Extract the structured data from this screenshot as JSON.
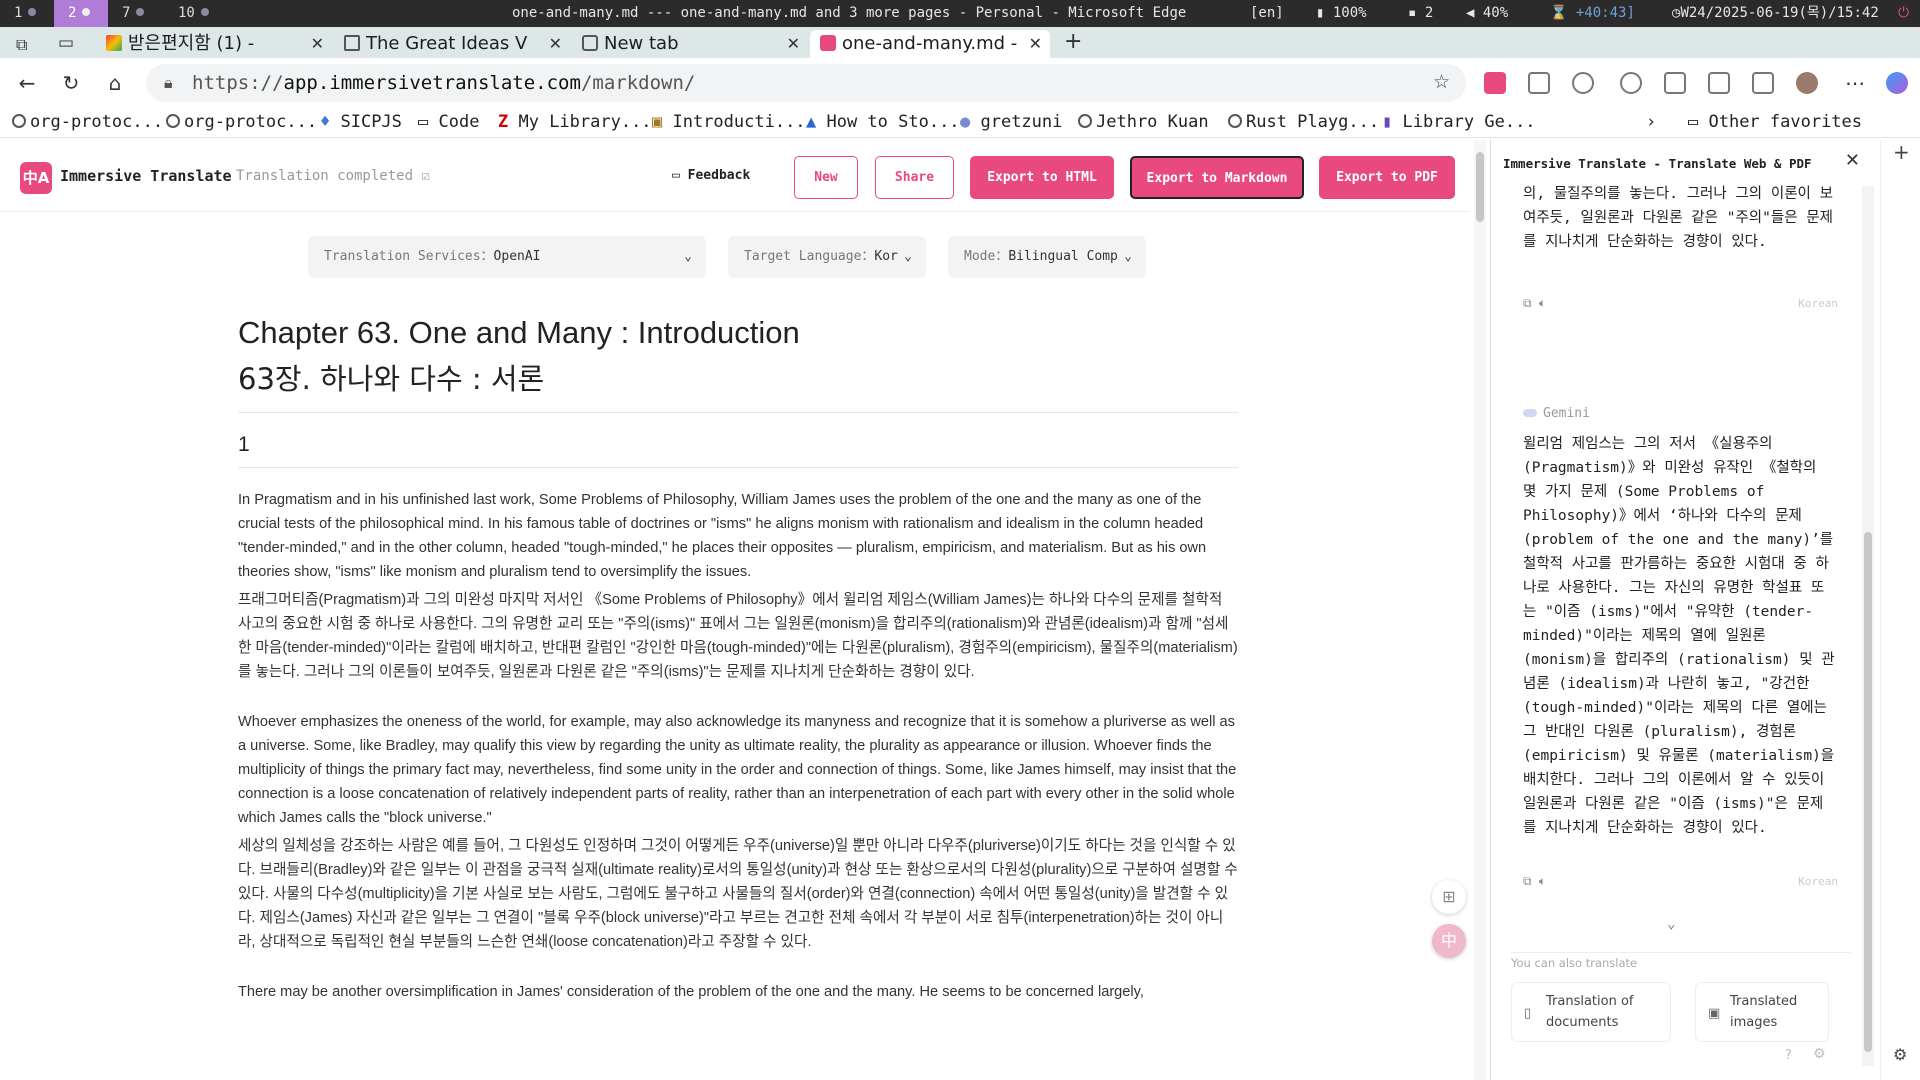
{
  "system_bar": {
    "workspaces": [
      {
        "label": "1",
        "active": false
      },
      {
        "label": "2",
        "active": true
      },
      {
        "label": "7",
        "active": false
      },
      {
        "label": "10",
        "active": false
      }
    ],
    "window_title": "one-and-many.md --- one-and-many.md and 3 more pages - Personal - Microsoft Edge",
    "input_method": "[en]",
    "battery": "100%",
    "notifications": "2",
    "volume": "40%",
    "timer": "+40:43]",
    "datetime": "W24/2025-06-19(목)/15:42"
  },
  "tabs": [
    {
      "title": "받은편지함 (1) - ",
      "icon": "gmail-icon",
      "active": false
    },
    {
      "title": "The Great Ideas V",
      "icon": "page-icon",
      "active": false
    },
    {
      "title": "New tab",
      "icon": "newtab-icon",
      "active": false
    },
    {
      "title": "one-and-many.md - ",
      "icon": "immersive-translate-icon",
      "active": true
    }
  ],
  "address_bar": {
    "url_prefix": "https://",
    "url_host": "app.immersivetranslate.com",
    "url_path": "/markdown/"
  },
  "bookmarks": [
    "org-protoc...",
    "org-protoc...",
    "SICPJS",
    "Code",
    "My Library...",
    "Introducti...",
    "How to Sto...",
    "gretzuni",
    "Jethro Kuan",
    "Rust Playg...",
    "Library Ge..."
  ],
  "other_favorites": "Other favorites",
  "app": {
    "name": "Immersive Translate",
    "logo_text": "中A",
    "status": "Translation completed",
    "feedback_label": "Feedback",
    "buttons": {
      "new": "New",
      "share": "Share",
      "export_html": "Export to HTML",
      "export_markdown": "Export to Markdown",
      "export_pdf": "Export to PDF"
    },
    "selectors": {
      "service_label": "Translation Services：",
      "service_value": "OpenAI",
      "lang_label": "Target Language：",
      "lang_value": "Kor",
      "mode_label": "Mode：",
      "mode_value": "Bilingual Comp"
    }
  },
  "document": {
    "title_en": "Chapter 63. One and Many : Introduction",
    "title_ko": "63장. 하나와 다수 : 서론",
    "section": "1",
    "paragraphs": [
      {
        "en": "In Pragmatism and in his unfinished last work, Some Problems of Philosophy, William James uses the problem of the one and the many as one of the crucial tests of the philosophical mind. In his famous table of doctrines or \"isms\" he aligns monism with rationalism and idealism in the column headed \"tender-minded,\" and in the other column, headed \"tough-minded,\" he places their opposites — pluralism, empiricism, and materialism. But as his own theories show, \"isms\" like monism and pluralism tend to oversimplify the issues.",
        "ko": "프래그머티즘(Pragmatism)과 그의 미완성 마지막 저서인 《Some Problems of Philosophy》에서 윌리엄 제임스(William James)는 하나와 다수의 문제를 철학적 사고의 중요한 시험 중 하나로 사용한다. 그의 유명한 교리 또는 \"주의(isms)\" 표에서 그는 일원론(monism)을 합리주의(rationalism)와 관념론(idealism)과 함께 \"섬세한 마음(tender-minded)\"이라는 칼럼에 배치하고, 반대편 칼럼인 \"강인한 마음(tough-minded)\"에는 다원론(pluralism), 경험주의(empiricism), 물질주의(materialism)를 놓는다. 그러나 그의 이론들이 보여주듯, 일원론과 다원론 같은 \"주의(isms)\"는 문제를 지나치게 단순화하는 경향이 있다."
      },
      {
        "en": "Whoever emphasizes the oneness of the world, for example, may also acknowledge its manyness and recognize that it is somehow a pluriverse as well as a universe. Some, like Bradley, may qualify this view by regarding the unity as ultimate reality, the plurality as appearance or illusion. Whoever finds the multiplicity of things the primary fact may, nevertheless, find some unity in the order and connection of things. Some, like James himself, may insist that the connection is a loose concatenation of relatively independent parts of reality, rather than an interpenetration of each part with every other in the solid whole which James calls the \"block universe.\"",
        "ko": "세상의 일체성을 강조하는 사람은 예를 들어, 그 다원성도 인정하며 그것이 어떻게든 우주(universe)일 뿐만 아니라 다우주(pluriverse)이기도 하다는 것을 인식할 수 있다. 브래들리(Bradley)와 같은 일부는 이 관점을 궁극적 실재(ultimate reality)로서의 통일성(unity)과 현상 또는 환상으로서의 다원성(plurality)으로 구분하여 설명할 수 있다. 사물의 다수성(multiplicity)을 기본 사실로 보는 사람도, 그럼에도 불구하고 사물들의 질서(order)와 연결(connection) 속에서 어떤 통일성(unity)을 발견할 수 있다. 제임스(James) 자신과 같은 일부는 그 연결이 \"블록 우주(block universe)\"라고 부르는 견고한 전체 속에서 각 부분이 서로 침투(interpenetration)하는 것이 아니라, 상대적으로 독립적인 현실 부분들의 느슨한 연쇄(loose concatenation)라고 주장할 수 있다."
      },
      {
        "en": "There may be another oversimplification in James' consideration of the problem of the one and the many. He seems to be concerned largely,",
        "ko": ""
      }
    ]
  },
  "panel": {
    "title": "Immersive Translate - Translate Web & PDF",
    "top_text": "의, 물질주의를 놓는다. 그러나 그의 이론이 보여주듯, 일원론과 다원론 같은 \"주의\"들은 문제를 지나치게 단순화하는 경향이 있다.",
    "lang_tag": "Korean",
    "gemini_label": "Gemini",
    "gemini_text": "윌리엄 제임스는 그의 저서 《실용주의(Pragmatism)》와 미완성 유작인 《철학의 몇 가지 문제 (Some Problems of Philosophy)》에서 ‘하나와 다수의 문제 (problem of the one and the many)’를 철학적 사고를 판가름하는 중요한 시험대 중 하나로 사용한다. 그는 자신의 유명한 학설표 또는 \"이즘 (isms)\"에서 \"유약한 (tender-minded)\"이라는 제목의 열에 일원론 (monism)을 합리주의 (rationalism) 및 관념론 (idealism)과 나란히 놓고, \"강건한 (tough-minded)\"이라는 제목의 다른 열에는 그 반대인 다원론 (pluralism), 경험론 (empiricism) 및 유물론 (materialism)을 배치한다. 그러나 그의 이론에서 알 수 있듯이 일원론과 다원론 같은 \"이즘 (isms)\"은 문제를 지나치게 단순화하는 경향이 있다.",
    "lang_tag2": "Korean",
    "also_translate": "You can also translate",
    "btn_documents": "Translation of documents",
    "btn_images": "Translated images"
  }
}
